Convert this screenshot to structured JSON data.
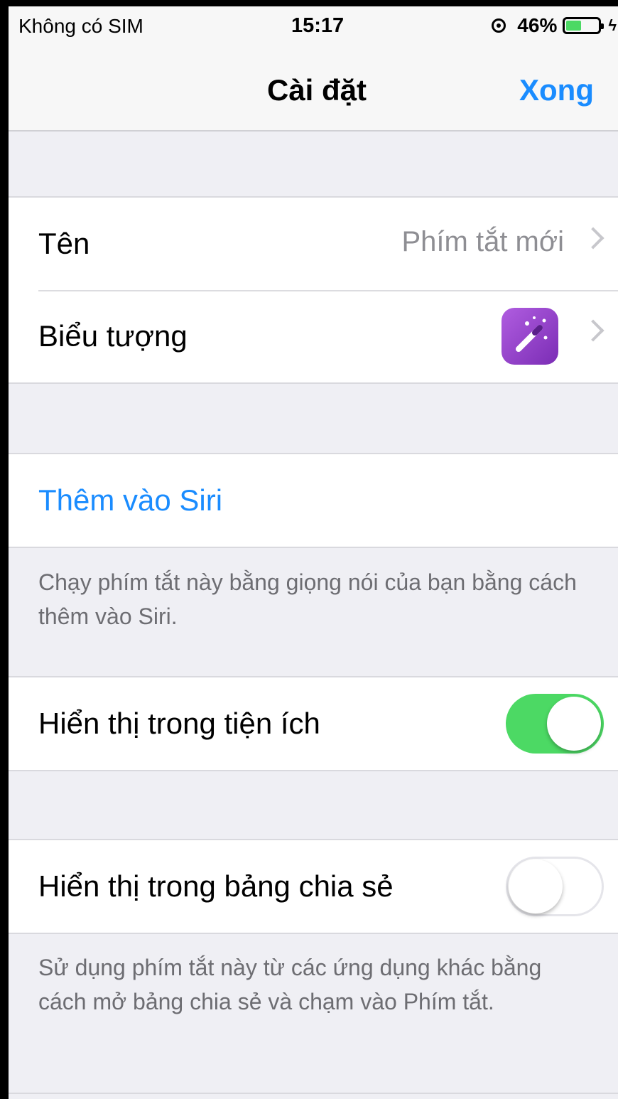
{
  "status_bar": {
    "carrier": "Không có SIM",
    "time": "15:17",
    "battery_percent": "46%",
    "battery_level": 0.46,
    "battery_color": "#4cd964"
  },
  "nav": {
    "title": "Cài đặt",
    "done_label": "Xong",
    "accent_color": "#1a8cff"
  },
  "settings": {
    "name_label": "Tên",
    "name_value": "Phím tắt mới",
    "icon_label": "Biểu tượng",
    "icon_name": "magic-wand-icon",
    "siri_label": "Thêm vào Siri",
    "siri_footer": "Chạy phím tắt này bằng giọng nói của bạn bằng cách thêm vào Siri.",
    "widget_label": "Hiển thị trong tiện ích",
    "widget_enabled": true,
    "share_label": "Hiển thị trong bảng chia sẻ",
    "share_enabled": false,
    "share_footer": "Sử dụng phím tắt này từ các ứng dụng khác bằng cách mở bảng chia sẻ và chạm vào Phím tắt."
  }
}
